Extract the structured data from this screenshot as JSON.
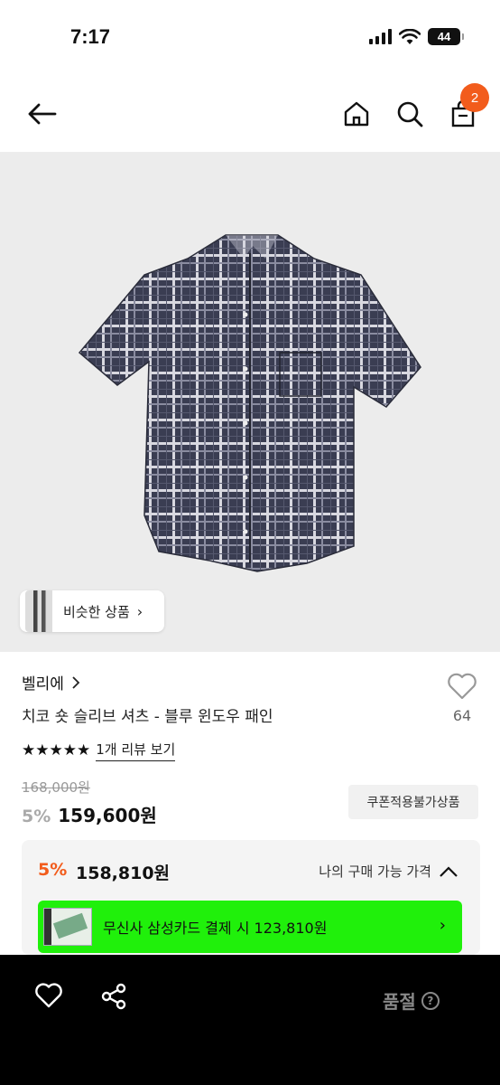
{
  "status_bar": {
    "time": "7:17",
    "battery": "44"
  },
  "nav": {
    "cart_count": "2"
  },
  "product": {
    "similar_label": "비슷한 상품",
    "brand": "벨리에",
    "title": "치코 숏 슬리브 셔츠 - 블루 윈도우 패인",
    "like_count": "64",
    "stars": "★★★★★",
    "review_link": "1개 리뷰 보기",
    "original_price": "168,000원",
    "sale_pct": "5%",
    "sale_price": "159,600원",
    "coupon_tag": "쿠폰적용불가상품"
  },
  "my_price": {
    "pct": "5%",
    "price": "158,810원",
    "label": "나의 구매 가능 가격",
    "card_text": "무신사 삼성카드 결제 시 123,810원"
  },
  "bottom_bar": {
    "status": "품절",
    "help": "?"
  },
  "colors": {
    "accent": "#f25c1c",
    "card_green": "#20f00b"
  }
}
